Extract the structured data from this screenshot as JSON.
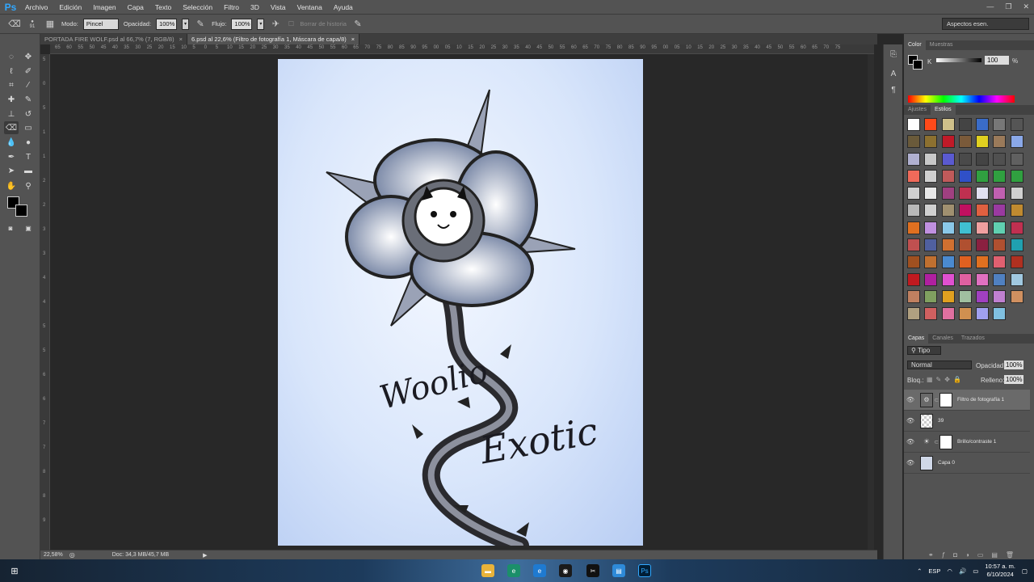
{
  "app": {
    "logo": "Ps"
  },
  "menu": [
    "Archivo",
    "Edición",
    "Imagen",
    "Capa",
    "Texto",
    "Selección",
    "Filtro",
    "3D",
    "Vista",
    "Ventana",
    "Ayuda"
  ],
  "window_controls": {
    "minimize": "—",
    "restore": "❐",
    "close": "✕"
  },
  "options": {
    "brush_size": "91",
    "mode_label": "Modo:",
    "mode_value": "Pincel",
    "opacity_label": "Opacidad:",
    "opacity_value": "100%",
    "flow_label": "Flujo:",
    "flow_value": "100%",
    "erase_history": "Borrar de historia",
    "workspace": "Aspectos esen."
  },
  "tabs": [
    {
      "label": "PORTADA FIRE WOLF.psd al 66,7% (7, RGB/8)",
      "close": "×"
    },
    {
      "label": "6.psd al 22,6% (Filtro de fotografía 1, Máscara de capa/8)",
      "close": "×"
    }
  ],
  "ruler_top": [
    "65",
    "60",
    "55",
    "50",
    "45",
    "40",
    "35",
    "30",
    "25",
    "20",
    "15",
    "10",
    "5",
    "0",
    "5",
    "10",
    "15",
    "20",
    "25",
    "30",
    "35",
    "40",
    "45",
    "50",
    "55",
    "60",
    "65",
    "70",
    "75",
    "80",
    "85",
    "90",
    "95",
    "00",
    "05",
    "10",
    "15",
    "20",
    "25",
    "30",
    "35",
    "40",
    "45",
    "50",
    "55",
    "60",
    "65",
    "70",
    "75",
    "80",
    "85",
    "90",
    "95",
    "00",
    "05",
    "10",
    "15",
    "20",
    "25",
    "30",
    "35",
    "40",
    "45",
    "50",
    "55",
    "60",
    "65",
    "70",
    "75"
  ],
  "ruler_left": [
    "5",
    "0",
    "5",
    "1",
    "1",
    "2",
    "2",
    "3",
    "3",
    "4",
    "4",
    "5",
    "5",
    "6",
    "6",
    "7",
    "7",
    "8",
    "8",
    "9"
  ],
  "artwork": {
    "text1": "Woolio",
    "text2": "Exotic"
  },
  "status": {
    "zoom": "22,58%",
    "doc": "Doc: 34,3 MB/45,7 MB"
  },
  "color_panel": {
    "tabs": [
      "Color",
      "Muestras"
    ],
    "channel": "K",
    "value": "100",
    "unit": "%"
  },
  "styles_panel": {
    "tabs": [
      "Ajustes",
      "Estilos"
    ]
  },
  "style_colors": [
    "#ffffff",
    "#ff4a1a",
    "#cfc08a",
    "#444444",
    "#3a6cc8",
    "#777777",
    "#555555",
    "#6a5a3a",
    "#8c7030",
    "#c01a28",
    "#7a5a3a",
    "#e0d020",
    "#9a7a5a",
    "#8aa8e8",
    "#b0b0d0",
    "#c8c8c8",
    "#5a5ad0",
    "#4a4a4a",
    "#444444",
    "#505050",
    "#606060",
    "#f06a5a",
    "#d0d0d0",
    "#c05a5a",
    "#3050c8",
    "#30a040",
    "#30a040",
    "#30a040",
    "#d0d0d0",
    "#e8e8e8",
    "#a04080",
    "#c03050",
    "#e0e0f0",
    "#c060b0",
    "#d0d0d0",
    "#b8b8b8",
    "#d0d0d0",
    "#a09070",
    "#c01060",
    "#e06040",
    "#9a3aa0",
    "#c08a30",
    "#e07020",
    "#c090e0",
    "#8ac8e8",
    "#40c0d0",
    "#f0a0a0",
    "#60d0b0",
    "#c03050",
    "#c05050",
    "#5060a0",
    "#d07030",
    "#b05030",
    "#8a2040",
    "#b05030",
    "#20a0b0",
    "#a05020",
    "#c07030",
    "#4a8ad0",
    "#e06020",
    "#e07020",
    "#e06070",
    "#b03020",
    "#c01a20",
    "#b020a0",
    "#e050d0",
    "#e060a0",
    "#e070c0",
    "#5080c0",
    "#a0c8e0",
    "#c08060",
    "#80a060",
    "#e0a020",
    "#a0c0a0",
    "#a040c0",
    "#c080d0",
    "#d09060",
    "#b0a080",
    "#d06060",
    "#e070a0",
    "#d09050",
    "#a0a0f0",
    "#80c0e0"
  ],
  "layers_panel": {
    "tabs": [
      "Capas",
      "Canales",
      "Trazados"
    ],
    "kind": "Tipo",
    "blend": "Normal",
    "opacity_label": "Opacidad:",
    "opacity_value": "100%",
    "lock_label": "Bloq.:",
    "fill_label": "Relleno:",
    "fill_value": "100%",
    "layers": [
      "Filtro de fotografía 1",
      "39",
      "Brillo/contraste 1",
      "Capa 0"
    ]
  },
  "taskbar": {
    "lang": "ESP",
    "time": "10:57 a. m.",
    "date": "6/10/2024"
  }
}
